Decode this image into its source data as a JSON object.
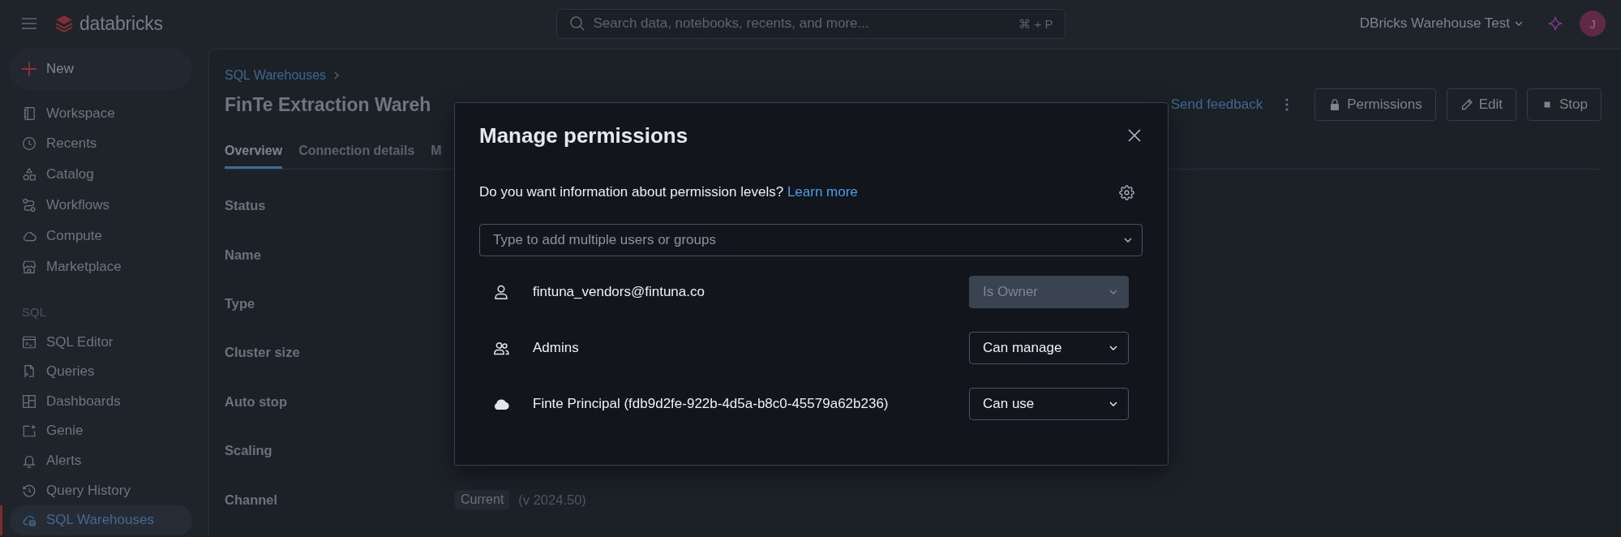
{
  "top_bar": {
    "logo": "databricks",
    "search": {
      "placeholder": "Search data, notebooks, recents, and more...",
      "shortcut": "⌘ + P"
    },
    "workspace": "DBricks Warehouse Test",
    "avatar": "J"
  },
  "sidebar": {
    "new_button": "New",
    "groups": [
      {
        "items": [
          {
            "label": "Workspace",
            "selected": false
          },
          {
            "label": "Recents",
            "selected": false
          },
          {
            "label": "Catalog",
            "selected": false
          },
          {
            "label": "Workflows",
            "selected": false
          },
          {
            "label": "Compute",
            "selected": false
          },
          {
            "label": "Marketplace",
            "selected": false
          }
        ]
      },
      {
        "heading": "SQL",
        "items": [
          {
            "label": "SQL Editor",
            "selected": false
          },
          {
            "label": "Queries",
            "selected": false
          },
          {
            "label": "Dashboards",
            "selected": false
          },
          {
            "label": "Genie",
            "selected": false
          },
          {
            "label": "Alerts",
            "selected": false
          },
          {
            "label": "Query History",
            "selected": false
          },
          {
            "label": "SQL Warehouses",
            "selected": true
          }
        ]
      }
    ]
  },
  "page": {
    "breadcrumb": [
      "SQL Warehouses"
    ],
    "title": "FinTe Extraction Wareh",
    "feedback_link": "Send feedback",
    "buttons": [
      "Permissions",
      "Edit",
      "Stop"
    ],
    "tabs": [
      {
        "label": "Overview",
        "selected": true
      },
      {
        "label": "Connection details",
        "selected": false
      },
      {
        "label": "M",
        "selected": false
      }
    ],
    "properties": [
      {
        "label": "Status"
      },
      {
        "label": "Name"
      },
      {
        "label": "Type"
      },
      {
        "label": "Cluster size"
      },
      {
        "label": "Auto stop"
      },
      {
        "label": "Scaling"
      },
      {
        "label": "Channel",
        "tag": "Current",
        "value": "(v 2024.50)"
      }
    ]
  },
  "modal": {
    "title": "Manage permissions",
    "info_text": "Do you want information about permission levels?",
    "info_link": "Learn more",
    "add_field": {
      "placeholder": "Type to add multiple users or groups"
    },
    "entries": [
      {
        "kind": "user",
        "name": "fintuna_vendors@fintuna.co",
        "permission": "Is Owner",
        "disabled": true
      },
      {
        "kind": "group",
        "name": "Admins",
        "permission": "Can manage",
        "disabled": false
      },
      {
        "kind": "service_principal",
        "name": "Finte Principal (fdb9d2fe-922b-4d5a-b8c0-45579a62b236)",
        "permission": "Can use",
        "disabled": false
      }
    ]
  }
}
